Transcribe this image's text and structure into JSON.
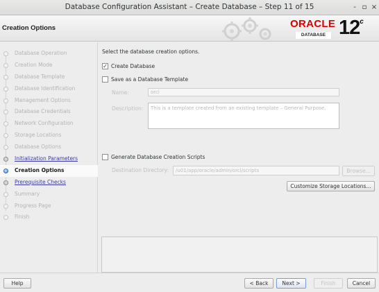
{
  "window": {
    "title": "Database Configuration Assistant – Create Database – Step 11 of 15",
    "minimize_glyph": "-",
    "maximize_glyph": "▫",
    "close_glyph": "×"
  },
  "header": {
    "page_title": "Creation Options",
    "brand_oracle": "ORACLE",
    "brand_database": "DATABASE",
    "version": "12",
    "version_sup": "c"
  },
  "sidebar": {
    "steps": [
      {
        "label": "Database Operation",
        "state": "disabled"
      },
      {
        "label": "Creation Mode",
        "state": "disabled"
      },
      {
        "label": "Database Template",
        "state": "disabled"
      },
      {
        "label": "Database Identification",
        "state": "disabled"
      },
      {
        "label": "Management Options",
        "state": "disabled"
      },
      {
        "label": "Database Credentials",
        "state": "disabled"
      },
      {
        "label": "Network Configuration",
        "state": "disabled"
      },
      {
        "label": "Storage Locations",
        "state": "disabled"
      },
      {
        "label": "Database Options",
        "state": "disabled"
      },
      {
        "label": "Initialization Parameters",
        "state": "link"
      },
      {
        "label": "Creation Options",
        "state": "current"
      },
      {
        "label": "Prerequisite Checks",
        "state": "link"
      },
      {
        "label": "Summary",
        "state": "disabled"
      },
      {
        "label": "Progress Page",
        "state": "disabled"
      },
      {
        "label": "Finish",
        "state": "disabled"
      }
    ]
  },
  "main": {
    "intro": "Select the database creation options.",
    "create_database": {
      "label": "Create Database",
      "checked": true,
      "check_glyph": "✓"
    },
    "save_template": {
      "label": "Save as a Database Template",
      "checked": false
    },
    "name_label": "Name:",
    "name_value": "orcl",
    "description_label": "Description:",
    "description_value": "This is a template created from an existing template – General Purpose.",
    "generate_scripts": {
      "label": "Generate Database Creation Scripts",
      "checked": false
    },
    "destination_label": "Destination Directory:",
    "destination_value": "/u01/app/oracle/admin/orcl/scripts",
    "browse_label": "Browse...",
    "customize_label": "Customize Storage Locations..."
  },
  "footer": {
    "help": "Help",
    "back": "< Back",
    "next": "Next >",
    "finish": "Finish",
    "cancel": "Cancel"
  }
}
